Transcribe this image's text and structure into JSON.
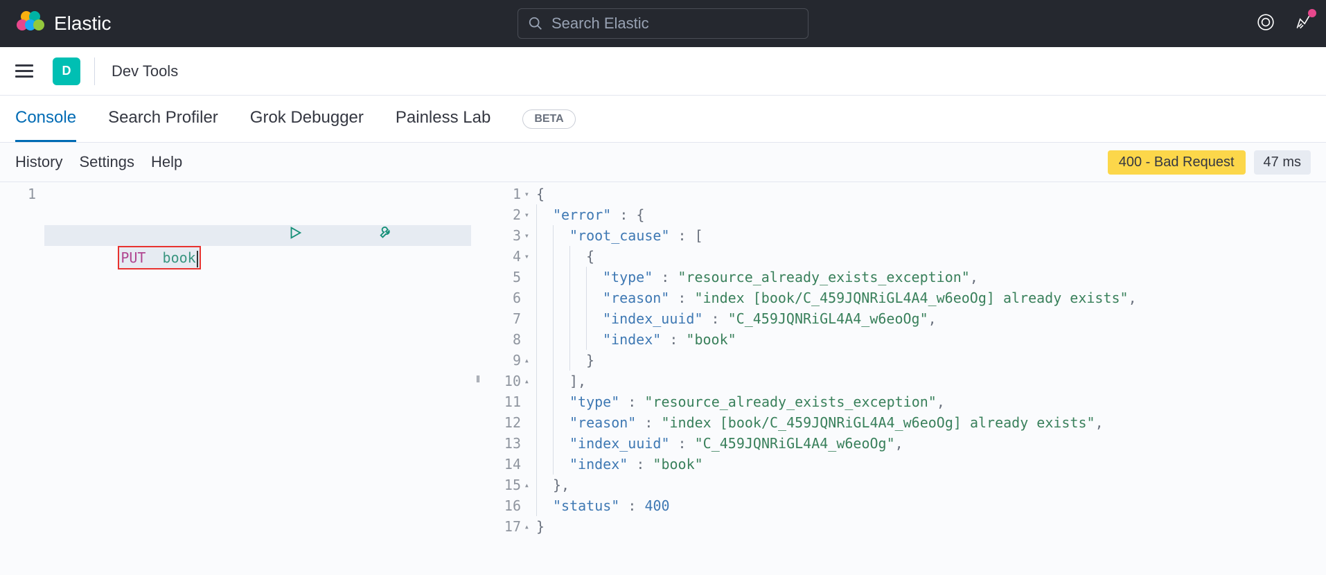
{
  "header": {
    "brand": "Elastic",
    "search_placeholder": "Search Elastic"
  },
  "subheader": {
    "space_letter": "D",
    "page_title": "Dev Tools"
  },
  "tabs": {
    "items": [
      {
        "label": "Console",
        "active": true
      },
      {
        "label": "Search Profiler",
        "active": false
      },
      {
        "label": "Grok Debugger",
        "active": false
      },
      {
        "label": "Painless Lab",
        "active": false
      }
    ],
    "beta_label": "BETA"
  },
  "toolbar": {
    "links": [
      "History",
      "Settings",
      "Help"
    ],
    "status_text": "400 - Bad Request",
    "time_text": "47 ms"
  },
  "request": {
    "line_number": "1",
    "method": "PUT",
    "path": "book"
  },
  "response": {
    "lines": [
      {
        "n": "1",
        "fold": "down",
        "indent": 0,
        "segs": [
          {
            "t": "{",
            "c": "json-punc"
          }
        ]
      },
      {
        "n": "2",
        "fold": "down",
        "indent": 1,
        "segs": [
          {
            "t": "\"error\"",
            "c": "json-key"
          },
          {
            "t": " : ",
            "c": "json-punc"
          },
          {
            "t": "{",
            "c": "json-punc"
          }
        ]
      },
      {
        "n": "3",
        "fold": "down",
        "indent": 2,
        "segs": [
          {
            "t": "\"root_cause\"",
            "c": "json-key"
          },
          {
            "t": " : ",
            "c": "json-punc"
          },
          {
            "t": "[",
            "c": "json-punc"
          }
        ]
      },
      {
        "n": "4",
        "fold": "down",
        "indent": 3,
        "segs": [
          {
            "t": "{",
            "c": "json-punc"
          }
        ]
      },
      {
        "n": "5",
        "fold": "",
        "indent": 4,
        "segs": [
          {
            "t": "\"type\"",
            "c": "json-key"
          },
          {
            "t": " : ",
            "c": "json-punc"
          },
          {
            "t": "\"resource_already_exists_exception\"",
            "c": "json-str"
          },
          {
            "t": ",",
            "c": "json-punc"
          }
        ]
      },
      {
        "n": "6",
        "fold": "",
        "indent": 4,
        "segs": [
          {
            "t": "\"reason\"",
            "c": "json-key"
          },
          {
            "t": " : ",
            "c": "json-punc"
          },
          {
            "t": "\"index [book/C_459JQNRiGL4A4_w6eoOg] already exists\"",
            "c": "json-str"
          },
          {
            "t": ",",
            "c": "json-punc"
          }
        ]
      },
      {
        "n": "7",
        "fold": "",
        "indent": 4,
        "segs": [
          {
            "t": "\"index_uuid\"",
            "c": "json-key"
          },
          {
            "t": " : ",
            "c": "json-punc"
          },
          {
            "t": "\"C_459JQNRiGL4A4_w6eoOg\"",
            "c": "json-str"
          },
          {
            "t": ",",
            "c": "json-punc"
          }
        ]
      },
      {
        "n": "8",
        "fold": "",
        "indent": 4,
        "segs": [
          {
            "t": "\"index\"",
            "c": "json-key"
          },
          {
            "t": " : ",
            "c": "json-punc"
          },
          {
            "t": "\"book\"",
            "c": "json-str"
          }
        ]
      },
      {
        "n": "9",
        "fold": "up",
        "indent": 3,
        "segs": [
          {
            "t": "}",
            "c": "json-punc"
          }
        ]
      },
      {
        "n": "10",
        "fold": "up",
        "indent": 2,
        "segs": [
          {
            "t": "],",
            "c": "json-punc"
          }
        ]
      },
      {
        "n": "11",
        "fold": "",
        "indent": 2,
        "segs": [
          {
            "t": "\"type\"",
            "c": "json-key"
          },
          {
            "t": " : ",
            "c": "json-punc"
          },
          {
            "t": "\"resource_already_exists_exception\"",
            "c": "json-str"
          },
          {
            "t": ",",
            "c": "json-punc"
          }
        ]
      },
      {
        "n": "12",
        "fold": "",
        "indent": 2,
        "segs": [
          {
            "t": "\"reason\"",
            "c": "json-key"
          },
          {
            "t": " : ",
            "c": "json-punc"
          },
          {
            "t": "\"index [book/C_459JQNRiGL4A4_w6eoOg] already exists\"",
            "c": "json-str"
          },
          {
            "t": ",",
            "c": "json-punc"
          }
        ]
      },
      {
        "n": "13",
        "fold": "",
        "indent": 2,
        "segs": [
          {
            "t": "\"index_uuid\"",
            "c": "json-key"
          },
          {
            "t": " : ",
            "c": "json-punc"
          },
          {
            "t": "\"C_459JQNRiGL4A4_w6eoOg\"",
            "c": "json-str"
          },
          {
            "t": ",",
            "c": "json-punc"
          }
        ]
      },
      {
        "n": "14",
        "fold": "",
        "indent": 2,
        "segs": [
          {
            "t": "\"index\"",
            "c": "json-key"
          },
          {
            "t": " : ",
            "c": "json-punc"
          },
          {
            "t": "\"book\"",
            "c": "json-str"
          }
        ]
      },
      {
        "n": "15",
        "fold": "up",
        "indent": 1,
        "segs": [
          {
            "t": "},",
            "c": "json-punc"
          }
        ]
      },
      {
        "n": "16",
        "fold": "",
        "indent": 1,
        "segs": [
          {
            "t": "\"status\"",
            "c": "json-key"
          },
          {
            "t": " : ",
            "c": "json-punc"
          },
          {
            "t": "400",
            "c": "json-num"
          }
        ]
      },
      {
        "n": "17",
        "fold": "up",
        "indent": 0,
        "segs": [
          {
            "t": "}",
            "c": "json-punc"
          }
        ]
      }
    ]
  }
}
